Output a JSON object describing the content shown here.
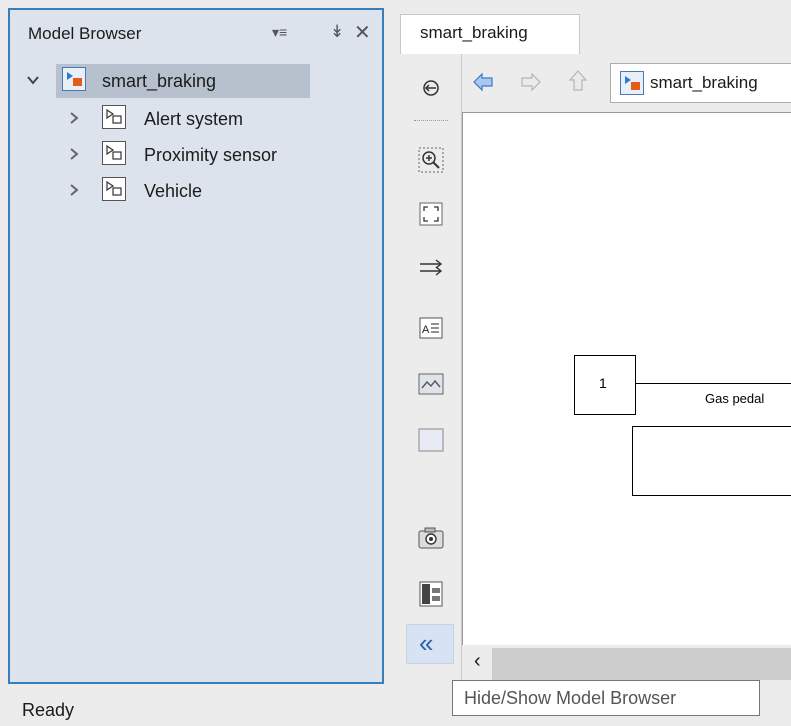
{
  "model_browser": {
    "title": "Model Browser",
    "menu_glyph": "▾≡",
    "pin_glyph": "↡",
    "close_glyph": "✕",
    "tree": {
      "root": {
        "label": "smart_braking",
        "expanded": true,
        "selected": true
      },
      "children": [
        {
          "label": "Alert system"
        },
        {
          "label": "Proximity sensor"
        },
        {
          "label": "Vehicle"
        }
      ]
    }
  },
  "tab": {
    "label": "smart_braking"
  },
  "breadcrumb": {
    "label": "smart_braking"
  },
  "canvas": {
    "block1_value": "1",
    "signal_label": "Gas pedal"
  },
  "toolbar": {
    "icons": [
      "expand-panel-icon",
      "zoom-in-icon",
      "fit-to-view-icon",
      "route-lines-icon",
      "annotation-icon",
      "image-icon",
      "area-icon",
      "screenshot-icon",
      "property-inspector-icon",
      "hide-show-browser-icon"
    ],
    "collapse_glyph": "«"
  },
  "navigation": {
    "back_glyph": "⇦",
    "forward_glyph": "⇨",
    "up_glyph": "⇧"
  },
  "scrollbar": {
    "left_glyph": "‹"
  },
  "status": {
    "text": "Ready"
  },
  "tooltip": {
    "text": "Hide/Show Model Browser"
  },
  "colors": {
    "panel_border": "#3a7dbd",
    "panel_bg": "#dce3ec",
    "selection_bg": "#b7c1cd",
    "nav_arrow": "#3d7ac4"
  }
}
